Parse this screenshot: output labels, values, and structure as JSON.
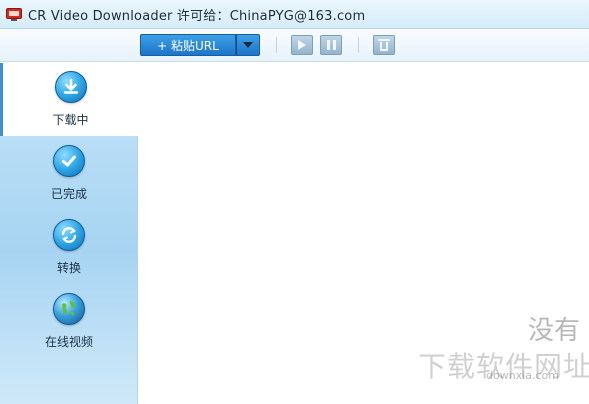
{
  "window": {
    "title": "CR Video Downloader  许可给：ChinaPYG@163.com"
  },
  "toolbar": {
    "paste_label": "+ 粘贴URL"
  },
  "sidebar": {
    "items": [
      {
        "label": "下载中",
        "icon": "download-icon",
        "active": true
      },
      {
        "label": "已完成",
        "icon": "check-icon",
        "active": false
      },
      {
        "label": "转换",
        "icon": "convert-icon",
        "active": false
      },
      {
        "label": "在线视频",
        "icon": "globe-icon",
        "active": false
      }
    ]
  },
  "main": {
    "empty_text": "没有"
  },
  "watermark": {
    "text": "下载软件网址",
    "url": "downxia.com"
  },
  "colors": {
    "accent": "#1d75c8",
    "sidebar_bg": "#b3daf4",
    "titlebar_bg": "#dff0fb"
  }
}
